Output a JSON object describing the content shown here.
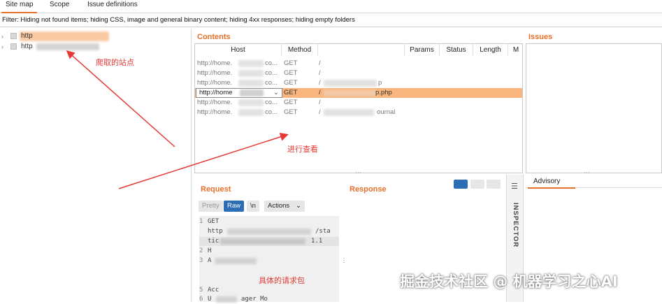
{
  "tabs": [
    {
      "label": "Site map",
      "active": true
    },
    {
      "label": "Scope",
      "active": false
    },
    {
      "label": "Issue definitions",
      "active": false
    }
  ],
  "filter_text": "Filter: Hiding not found items;  hiding CSS, image and general binary content;  hiding 4xx responses;  hiding empty folders",
  "tree": {
    "items": [
      {
        "label": "http",
        "selected": true
      },
      {
        "label": "http",
        "selected": false
      }
    ]
  },
  "contents": {
    "title": "Contents",
    "columns": [
      "Host",
      "Method",
      "",
      "Params",
      "Status",
      "Length",
      "M"
    ],
    "rows": [
      {
        "host": "http://home.",
        "host_tail": "co...",
        "method": "GET",
        "path": "/",
        "path_tail": "",
        "selected": false
      },
      {
        "host": "http://home.",
        "host_tail": "co...",
        "method": "GET",
        "path": "/",
        "path_tail": "",
        "selected": false
      },
      {
        "host": "http://home.",
        "host_tail": "co...",
        "method": "GET",
        "path": "/",
        "path_tail": "p",
        "selected": false
      },
      {
        "host": "http://home",
        "host_tail": "",
        "method": "GET",
        "path": "/",
        "path_tail": "p.php",
        "selected": true
      },
      {
        "host": "http://home.",
        "host_tail": "co...",
        "method": "GET",
        "path": "/",
        "path_tail": "",
        "selected": false
      },
      {
        "host": "http://home.",
        "host_tail": "co...",
        "method": "GET",
        "path": "/",
        "path_tail": "ournal",
        "selected": false
      }
    ]
  },
  "issues": {
    "title": "Issues"
  },
  "request": {
    "title": "Request",
    "buttons": {
      "pretty": "Pretty",
      "raw": "Raw",
      "newline": "\\n",
      "actions": "Actions"
    },
    "lines": [
      {
        "num": "1",
        "text": "GET"
      },
      {
        "num": "",
        "text": "http",
        "tail": "/sta"
      },
      {
        "num": "",
        "text": "tic",
        "tail": "1.1"
      },
      {
        "num": "2",
        "text": "H"
      },
      {
        "num": "3",
        "text": "A"
      },
      {
        "num": "",
        "text": ""
      },
      {
        "num": "",
        "text": ""
      },
      {
        "num": "5",
        "text": "Acc"
      },
      {
        "num": "6",
        "text": "U",
        "tail": "ager   Mo"
      }
    ]
  },
  "response": {
    "title": "Response"
  },
  "inspector": {
    "label": "INSPECTOR"
  },
  "advisory": {
    "tab": "Advisory"
  },
  "annotations": {
    "crawled_sites": "爬取的站点",
    "view": "进行查看",
    "request_packet": "具体的请求包"
  },
  "watermark": "掘金技术社区 @ 机器学习之心AI",
  "colors": {
    "accent": "#e8702a",
    "selected_row": "#f8b57e",
    "raw_button": "#2c6eb5",
    "annotation": "#e53935"
  }
}
